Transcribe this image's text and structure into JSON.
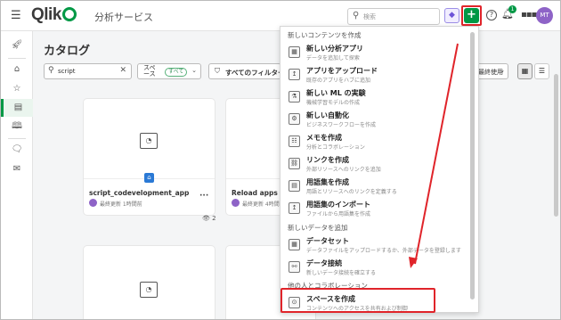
{
  "header": {
    "logo_text": "Qlik",
    "app_title": "分析サービス",
    "search_placeholder": "検索",
    "notification_count": "1",
    "avatar_initials": "MT"
  },
  "catalog": {
    "title": "カタログ",
    "search_value": "script",
    "space_filter_label": "スペース",
    "space_filter_pill": "すべて",
    "all_filters_label": "すべてのフィルター",
    "sort_label": "最終使用",
    "views_count": "2"
  },
  "cards": [
    {
      "name": "script_codevelopment_app",
      "meta": "最終更新 1時間前"
    },
    {
      "name": "Reload apps as a s",
      "meta": "最終更新 4時間前"
    }
  ],
  "menu": {
    "section_new_content": "新しいコンテンツを作成",
    "section_new_data": "新しいデータを追加",
    "section_collab": "他の人とコラボレーション",
    "items": [
      {
        "title": "新しい分析アプリ",
        "desc": "データを追加して探索",
        "icon": "analytics-app-icon"
      },
      {
        "title": "アプリをアップロード",
        "desc": "既存のアプリをハブに追加",
        "icon": "upload-icon"
      },
      {
        "title": "新しい ML の実験",
        "desc": "機械学習モデルの作成",
        "icon": "flask-icon"
      },
      {
        "title": "新しい自動化",
        "desc": "ビジネスワークフローを作成",
        "icon": "automation-icon"
      },
      {
        "title": "メモを作成",
        "desc": "分析とコラボレーション",
        "icon": "note-icon"
      },
      {
        "title": "リンクを作成",
        "desc": "外部リソースへのリンクを追加",
        "icon": "link-icon"
      },
      {
        "title": "用語集を作成",
        "desc": "用語とリソースへのリンクを定義する",
        "icon": "glossary-icon"
      },
      {
        "title": "用語集のインポート",
        "desc": "ファイルから用語集を作成",
        "icon": "import-icon"
      }
    ],
    "data_items": [
      {
        "title": "データセット",
        "desc": "データファイルをアップロードするか、外部データを登録します",
        "icon": "dataset-icon"
      },
      {
        "title": "データ接続",
        "desc": "新しいデータ接続を確立する",
        "icon": "connection-icon"
      }
    ],
    "collab_items": [
      {
        "title": "スペースを作成",
        "desc": "コンテンツへのアクセスを共有および制御",
        "icon": "space-icon"
      }
    ]
  },
  "colors": {
    "brand_green": "#009845",
    "highlight_red": "#e0242a",
    "avatar_purple": "#8e63c7"
  }
}
